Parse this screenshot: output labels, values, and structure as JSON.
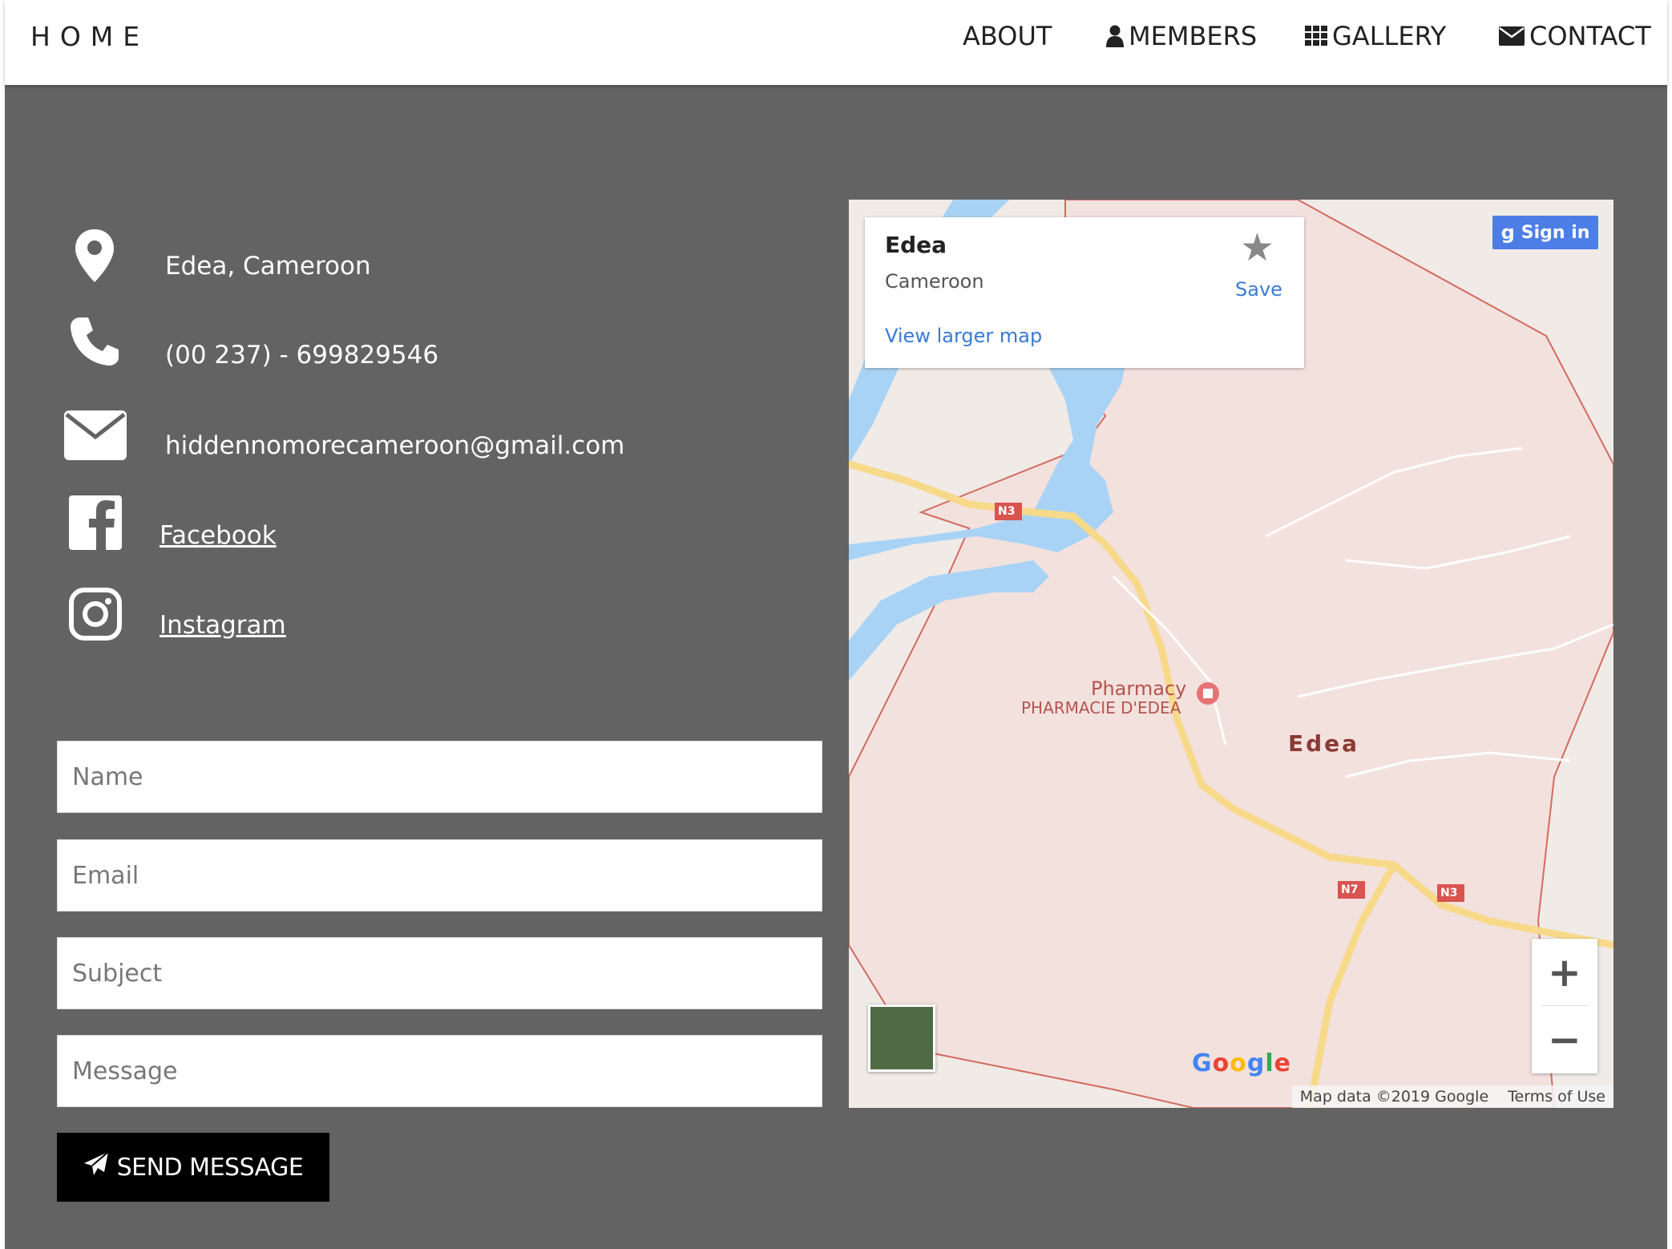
{
  "navbar": {
    "brand": "HOME",
    "items": [
      {
        "label": "ABOUT",
        "icon": ""
      },
      {
        "label": "MEMBERS",
        "icon": "user-icon"
      },
      {
        "label": "GALLERY",
        "icon": "grid-icon"
      },
      {
        "label": "CONTACT",
        "icon": "envelope-icon"
      }
    ]
  },
  "contact": {
    "location": "Edea, Cameroon",
    "phone": "(00 237) - 699829546",
    "email": "hiddennomorecameroon@gmail.com",
    "facebook": "Facebook",
    "instagram": "Instagram"
  },
  "form": {
    "name_placeholder": "Name",
    "email_placeholder": "Email",
    "subject_placeholder": "Subject",
    "message_placeholder": "Message",
    "send_label": "SEND MESSAGE"
  },
  "map": {
    "card_title": "Edea",
    "card_subtitle": "Cameroon",
    "save_label": "Save",
    "larger_map_label": "View larger map",
    "signin_label": "Sign in",
    "place_label": "Edea",
    "pharmacy_label": "Pharmacy",
    "pharmacy_sub": "PHARMACIE D'EDEA",
    "road_n3": "N3",
    "road_n7": "N7",
    "map_data": "Map data ©2019 Google",
    "terms": "Terms of Use",
    "google_logo": "Google",
    "colors": {
      "water": "#a3d1f5",
      "road": "#f7d98a",
      "area": "#f4e1de",
      "border": "#d9534f"
    }
  }
}
